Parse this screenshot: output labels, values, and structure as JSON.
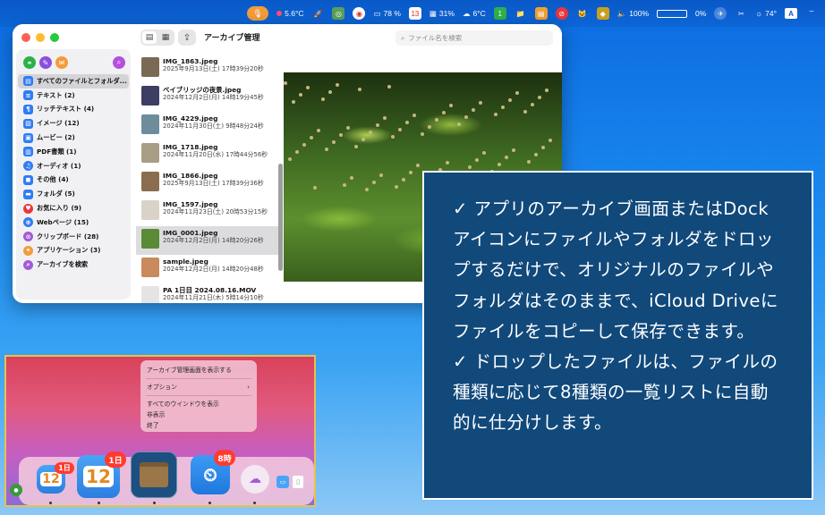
{
  "menubar": {
    "temp1": "5.6°C",
    "cpu": "78 %",
    "calendar_day": "13",
    "mem": "31%",
    "temp2": "6°C",
    "green_badge": "1",
    "volume": "100%",
    "brightness": "0%",
    "temp3": "74°",
    "input_source": "A"
  },
  "window": {
    "title": "アーカイブ管理",
    "search_placeholder": "ファイル名を検索",
    "sidebar_items": [
      {
        "label": "すべてのファイルとフォルダ...",
        "icon": "doc-stack-icon",
        "color": "#2f7cf6"
      },
      {
        "label": "テキスト (2)",
        "icon": "text-doc-icon",
        "color": "#2f7cf6"
      },
      {
        "label": "リッチテキスト (4)",
        "icon": "rich-text-icon",
        "color": "#2f7cf6"
      },
      {
        "label": "イメージ (12)",
        "icon": "photo-icon",
        "color": "#2f7cf6"
      },
      {
        "label": "ムービー (2)",
        "icon": "film-icon",
        "color": "#2f7cf6"
      },
      {
        "label": "PDF書類 (1)",
        "icon": "pdf-icon",
        "color": "#2f7cf6"
      },
      {
        "label": "オーディオ (1)",
        "icon": "headphones-icon",
        "color": "#2f7cf6"
      },
      {
        "label": "その他 (4)",
        "icon": "other-icon",
        "color": "#2f7cf6"
      },
      {
        "label": "フォルダ (5)",
        "icon": "folder-icon",
        "color": "#2f7cf6"
      },
      {
        "label": "お気に入り (9)",
        "icon": "heart-icon",
        "color": "#e8373d"
      },
      {
        "label": "Webページ (15)",
        "icon": "globe-icon",
        "color": "#2f7cf6"
      },
      {
        "label": "クリップボード (28)",
        "icon": "clip-icon",
        "color": "#a15bd8"
      },
      {
        "label": "アプリケーション (3)",
        "icon": "app-icon",
        "color": "#f39c3a"
      },
      {
        "label": "アーカイブを検索",
        "icon": "search-icon",
        "color": "#a15bd8"
      }
    ],
    "files": [
      {
        "name": "IMG_1863.jpeg",
        "date": "2025年9月13日(土) 17時39分20秒",
        "thumb": "#7a6a55"
      },
      {
        "name": "ベイブリッジの夜景.jpeg",
        "date": "2024年12月2日(月) 14時19分45秒",
        "thumb": "#3c3f63"
      },
      {
        "name": "IMG_4229.jpeg",
        "date": "2024年11月30日(土) 9時48分24秒",
        "thumb": "#6f8c9c"
      },
      {
        "name": "IMG_1718.jpeg",
        "date": "2024年11月20日(水) 17時44分56秒",
        "thumb": "#a89e86"
      },
      {
        "name": "IMG_1866.jpeg",
        "date": "2025年9月13日(土) 17時39分36秒",
        "thumb": "#8a6d4e"
      },
      {
        "name": "IMG_1597.jpeg",
        "date": "2024年11月23日(土) 20時53分15秒",
        "thumb": "#d9d3c7"
      },
      {
        "name": "IMG_0001.jpeg",
        "date": "2024年12月2日(月) 14時20分26秒",
        "thumb": "#5a8a35"
      },
      {
        "name": "sample.jpeg",
        "date": "2024年12月2日(月) 14時20分48秒",
        "thumb": "#c98a5c"
      },
      {
        "name": "PA 1日目 2024.08.16.MOV",
        "date": "2024年11月21日(木) 5時14分10秒",
        "thumb": "#e4e4e4"
      }
    ],
    "selected_file_index": 6
  },
  "context_menu": {
    "items": [
      "アーカイブ管理画面を表示する",
      "オプション",
      "すべてのウインドウを表示",
      "非表示",
      "終了"
    ]
  },
  "dock": {
    "app1_day": "12",
    "app1_badge": "1日",
    "app2_day": "12",
    "app2_badge": "1日",
    "app4_badge": "8時"
  },
  "callout": {
    "text": "✓ アプリのアーカイブ画面またはDockアイコンにファイルやフォルダをドロップするだけで、オリジナルのファイルやフォルダはそのままで、iCloud Driveにファイルをコピーして保存できます。\n✓ ドロップしたファイルは、ファイルの種類に応じて8種類の一覧リストに自動的に仕分けします。"
  },
  "colors": {
    "callout_bg": "#11497b",
    "accent_blue": "#2f7cf6"
  }
}
